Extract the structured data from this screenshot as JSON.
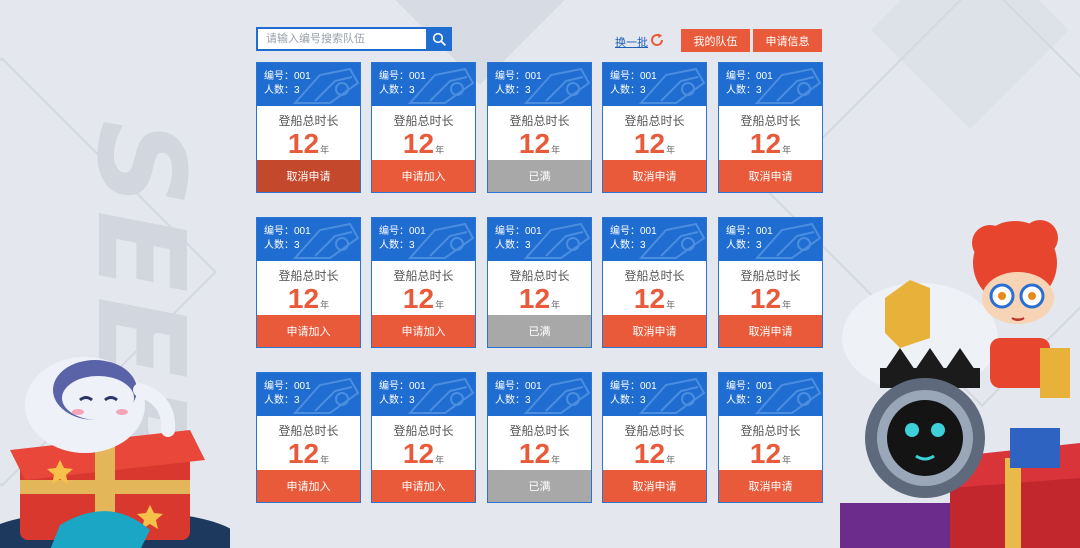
{
  "search": {
    "placeholder": "请输入编号搜索队伍",
    "value": ""
  },
  "header": {
    "refresh_label": "换一批",
    "my_team_label": "我的队伍",
    "apply_info_label": "申请信息"
  },
  "watermark_text": "SEER",
  "card_texts": {
    "id_prefix": "编号：",
    "count_prefix": "人数：",
    "duration_label": "登船总时长",
    "unit": "年"
  },
  "teams": [
    {
      "id": "001",
      "members": "3",
      "duration": "12",
      "action": "取消申请",
      "state": "cancel-dark"
    },
    {
      "id": "001",
      "members": "3",
      "duration": "12",
      "action": "申请加入",
      "state": "join"
    },
    {
      "id": "001",
      "members": "3",
      "duration": "12",
      "action": "已满",
      "state": "full"
    },
    {
      "id": "001",
      "members": "3",
      "duration": "12",
      "action": "取消申请",
      "state": "cancel"
    },
    {
      "id": "001",
      "members": "3",
      "duration": "12",
      "action": "取消申请",
      "state": "cancel"
    },
    {
      "id": "001",
      "members": "3",
      "duration": "12",
      "action": "申请加入",
      "state": "join"
    },
    {
      "id": "001",
      "members": "3",
      "duration": "12",
      "action": "申请加入",
      "state": "join"
    },
    {
      "id": "001",
      "members": "3",
      "duration": "12",
      "action": "已满",
      "state": "full"
    },
    {
      "id": "001",
      "members": "3",
      "duration": "12",
      "action": "取消申请",
      "state": "cancel"
    },
    {
      "id": "001",
      "members": "3",
      "duration": "12",
      "action": "取消申请",
      "state": "cancel"
    },
    {
      "id": "001",
      "members": "3",
      "duration": "12",
      "action": "申请加入",
      "state": "join"
    },
    {
      "id": "001",
      "members": "3",
      "duration": "12",
      "action": "申请加入",
      "state": "join"
    },
    {
      "id": "001",
      "members": "3",
      "duration": "12",
      "action": "已满",
      "state": "full"
    },
    {
      "id": "001",
      "members": "3",
      "duration": "12",
      "action": "取消申请",
      "state": "cancel"
    },
    {
      "id": "001",
      "members": "3",
      "duration": "12",
      "action": "取消申请",
      "state": "cancel"
    }
  ],
  "colors": {
    "accent_blue": "#1f6dd1",
    "accent_orange": "#e95a3a",
    "full_gray": "#a8a8a8"
  }
}
